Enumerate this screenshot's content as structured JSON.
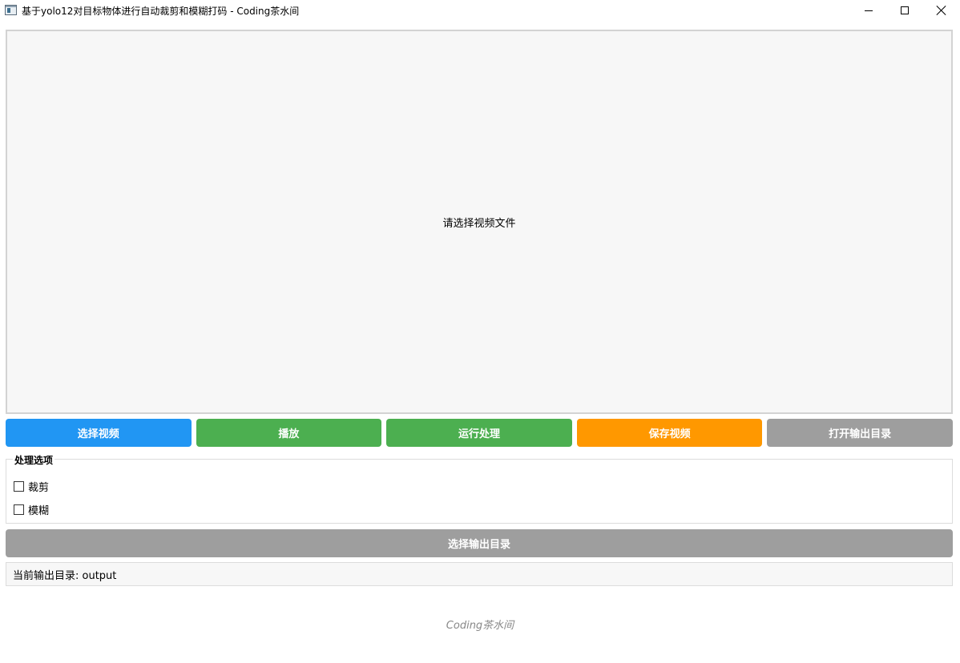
{
  "window": {
    "title": "基于yolo12对目标物体进行自动裁剪和模糊打码 - Coding茶水间",
    "icon": "app-window-icon",
    "controls": {
      "minimize_icon": "minimize-icon",
      "maximize_icon": "maximize-icon",
      "close_icon": "close-icon"
    }
  },
  "video": {
    "placeholder": "请选择视频文件"
  },
  "buttons": [
    {
      "label": "选择视频",
      "color": "#2196f3"
    },
    {
      "label": "播放",
      "color": "#4caf50"
    },
    {
      "label": "运行处理",
      "color": "#4caf50"
    },
    {
      "label": "保存视频",
      "color": "#ff9800"
    },
    {
      "label": "打开输出目录",
      "color": "#9e9e9e"
    }
  ],
  "options": {
    "title": "处理选项",
    "items": [
      {
        "label": "裁剪",
        "checked": false
      },
      {
        "label": "模糊",
        "checked": false
      }
    ]
  },
  "output": {
    "button_label": "选择输出目录",
    "button_color": "#9e9e9e",
    "current_label": "当前输出目录: output"
  },
  "footer": {
    "text": "Coding茶水间"
  }
}
